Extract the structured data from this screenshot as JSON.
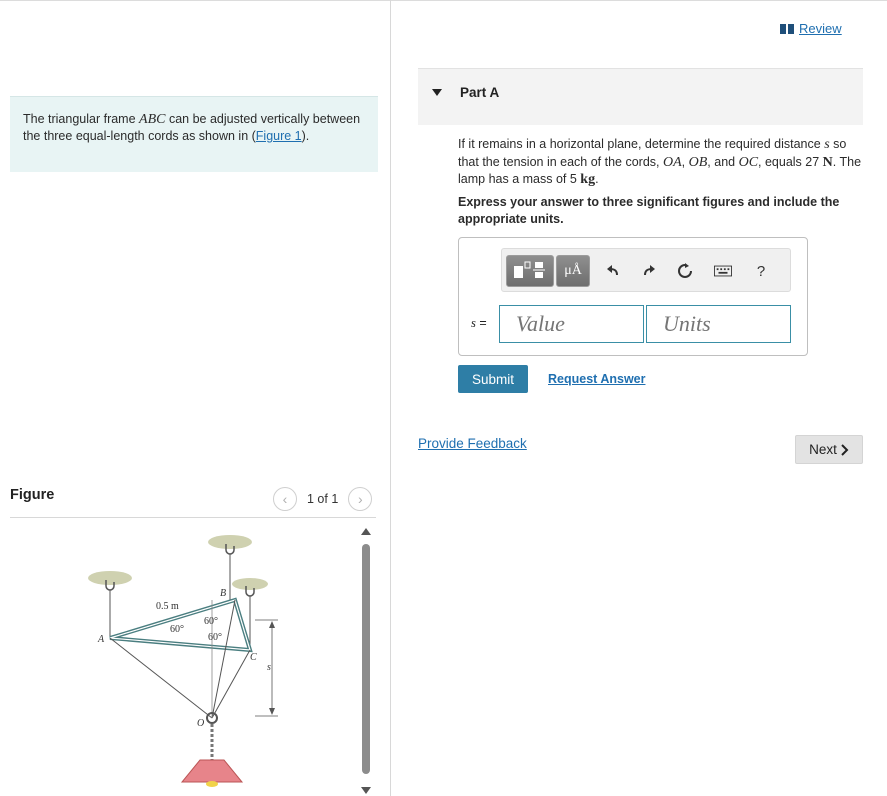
{
  "problem": {
    "text_before": "The triangular frame ",
    "frame_name": "ABC",
    "text_after": " can be adjusted vertically between the three equal-length cords as shown in (",
    "figure_link": "Figure 1",
    "text_end": ")."
  },
  "figure": {
    "label": "Figure",
    "pager_text": "1 of 1",
    "labels": {
      "length": "0.5 m",
      "angle_a": "60°",
      "angle_b1": "60°",
      "angle_b2": "60°",
      "point_a": "A",
      "point_b": "B",
      "point_c": "C",
      "point_o": "O",
      "dim_s": "s"
    }
  },
  "review": {
    "label": "Review"
  },
  "part": {
    "title": "Part A"
  },
  "question": {
    "t1": "If it remains in a horizontal plane, determine the required distance ",
    "var_s": "s",
    "t2": " so that the tension in each of the cords, ",
    "oa": "OA",
    "sep1": ", ",
    "ob": "OB",
    "t3": ", and ",
    "oc": "OC",
    "t4": ", equals 27 ",
    "unit_n": "N",
    "t5": ". The lamp has a mass of 5 ",
    "unit_kg": "kg",
    "t6": "."
  },
  "instruction": "Express your answer to three significant figures and include the appropriate units.",
  "answer": {
    "label_var": "s",
    "label_eq": " =",
    "value_placeholder": "Value",
    "units_placeholder": "Units",
    "toolbar": {
      "units_symbol": "μÅ",
      "help": "?"
    }
  },
  "buttons": {
    "submit": "Submit",
    "request_answer": "Request Answer",
    "provide_feedback": "Provide Feedback",
    "next": "Next"
  }
}
